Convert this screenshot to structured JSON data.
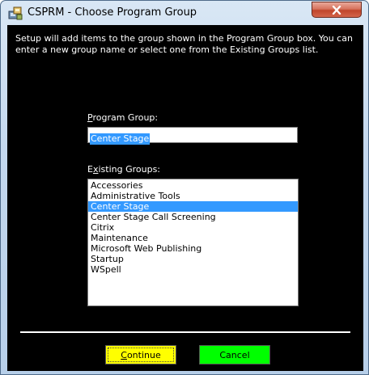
{
  "window": {
    "title": "CSPRM - Choose Program Group",
    "close_icon": "close-icon"
  },
  "dialog": {
    "intro_text": "Setup will add items to the group shown in the Program Group box. You can enter a new group name or select one from the Existing Groups list.",
    "program_group_label_first": "P",
    "program_group_label_rest": "rogram Group:",
    "program_group_value": "Center Stage",
    "existing_groups_label_first": "E",
    "existing_groups_label_rest_a": "x",
    "existing_groups_label_rest_b": "isting Groups:",
    "existing_groups": [
      "Accessories",
      "Administrative Tools",
      "Center Stage",
      "Center Stage Call Screening",
      "Citrix",
      "Maintenance",
      "Microsoft Web Publishing",
      "Startup",
      "WSpell"
    ],
    "selected_group": "Center Stage"
  },
  "buttons": {
    "continue_first": "C",
    "continue_rest": "ontinue",
    "cancel": "Cancel",
    "continue_color": "#ffff00",
    "cancel_color": "#00ff00"
  }
}
